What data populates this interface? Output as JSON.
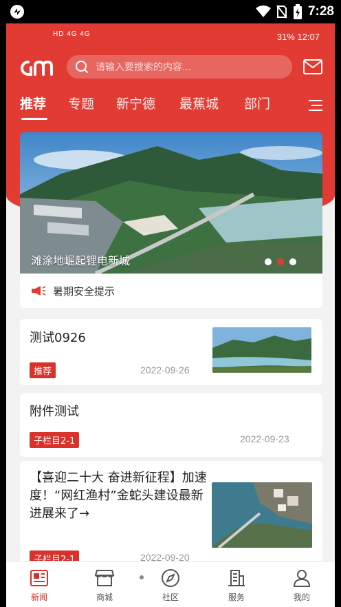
{
  "system_status": {
    "time": "7:28"
  },
  "app_status": {
    "left_text": "HD 4G 4G",
    "right_text": "31% 12:07"
  },
  "search": {
    "placeholder": "请输入要搜索的内容..."
  },
  "tabs": [
    {
      "label": "推荐",
      "active": true
    },
    {
      "label": "专题"
    },
    {
      "label": "新宁德"
    },
    {
      "label": "最蕉城"
    },
    {
      "label": "部门"
    }
  ],
  "banner": {
    "caption": "滩涂地崛起锂电新城",
    "slide_count": 3,
    "active_slide": 2
  },
  "notice": {
    "text": "暑期安全提示"
  },
  "articles": [
    {
      "title": "测试0926",
      "tag": "推荐",
      "date": "2022-09-26"
    },
    {
      "title": "附件测试",
      "tag": "子栏目2-1",
      "date": "2022-09-23"
    },
    {
      "title": "【喜迎二十大 奋进新征程】加速度！“网红渔村”金蛇头建设最新进展来了→",
      "tag": "子栏目2-1",
      "date": "2022-09-20"
    }
  ],
  "bottom_nav": [
    {
      "label": "新闻",
      "icon": "newspaper-icon",
      "active": true
    },
    {
      "label": "商城",
      "icon": "store-icon"
    },
    {
      "label": "社区",
      "icon": "compass-icon"
    },
    {
      "label": "服务",
      "icon": "building-icon"
    },
    {
      "label": "我的",
      "icon": "user-icon"
    }
  ],
  "colors": {
    "brand": "#e23b34",
    "tag": "#d8322b"
  }
}
